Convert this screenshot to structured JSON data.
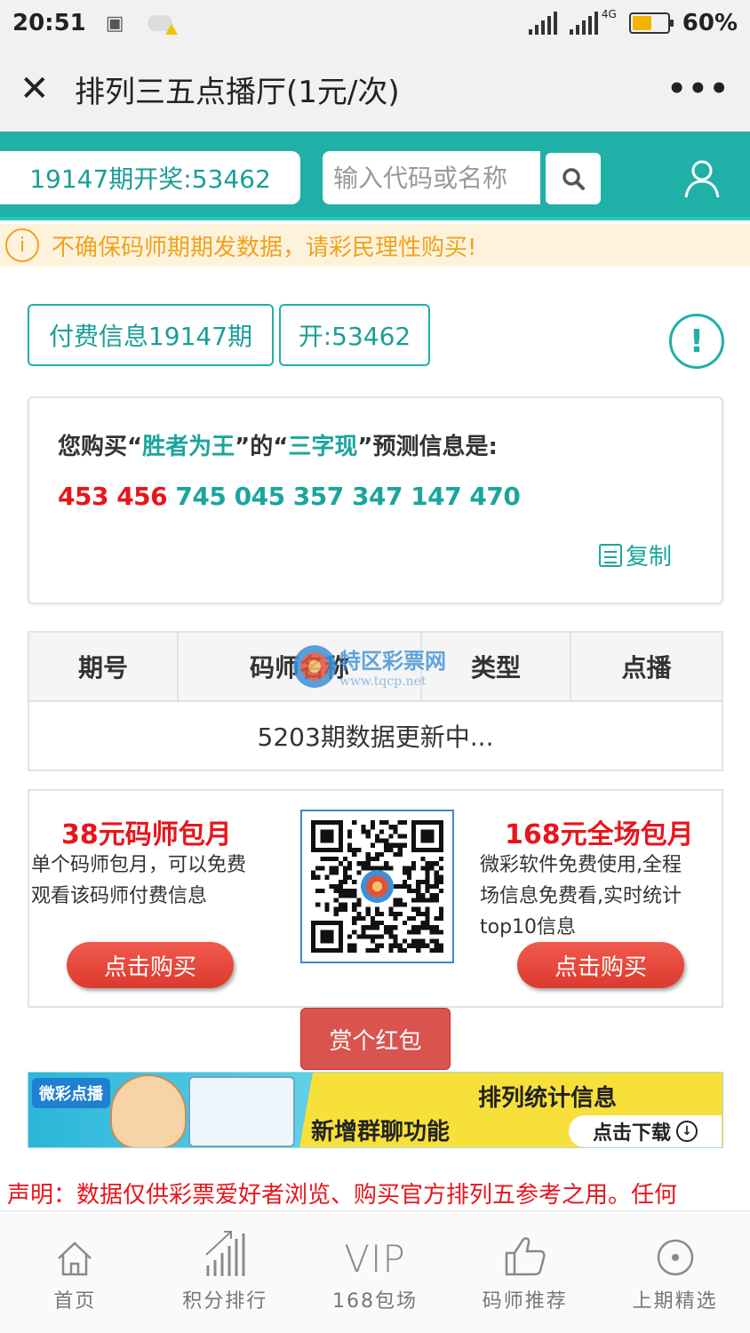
{
  "status_bar": {
    "time": "20:51",
    "network": "4G",
    "battery": "60%",
    "battery_level": 0.6
  },
  "titlebar": {
    "title": "排列三五点播厅(1元/次)",
    "close_icon": "close-icon",
    "more_icon": "more-dots-icon"
  },
  "header": {
    "draw_result": "19147期开奖:53462",
    "search_placeholder": "输入代码或名称",
    "accent_color": "#1fb0a8"
  },
  "warning": {
    "text": "不确保码师期期发数据，请彩民理性购买!",
    "color": "#f0a21e"
  },
  "info": {
    "paid_tag": "付费信息19147期",
    "open_tag": "开:53462",
    "alert_symbol": "!"
  },
  "prediction": {
    "prefix": "您购买",
    "lq1": "“",
    "rq1": "”",
    "master": "胜者为王",
    "mid": "的",
    "lq2": "“",
    "rq2": "”",
    "type": "三字现",
    "suffix": "预测信息是:",
    "numbers_red": "453 456",
    "numbers_teal": "745 045 357 347 147 470",
    "copy_label": "复制"
  },
  "table": {
    "headers": [
      "期号",
      "码师名称",
      "类型",
      "点播"
    ],
    "empty_message": "5203期数据更新中..."
  },
  "watermark": {
    "text": "特区彩票网",
    "url": "www.tqcp.net"
  },
  "promo": {
    "left_title": "38元码师包月",
    "left_desc_1": "单个码师包月，可以免费",
    "left_desc_2": "观看该码师付费信息",
    "left_button": "点击购买",
    "right_title": "168元全场包月",
    "right_desc_1": "微彩软件免费使用,全程",
    "right_desc_2": "场信息免费看,实时统计",
    "right_desc_3": "top10信息",
    "right_button": "点击购买"
  },
  "redpack_button": "赏个红包",
  "banner": {
    "brand": "微彩点播",
    "line1": "排列统计信息",
    "line2": "新增群聊功能",
    "download": "点击下载"
  },
  "notice": "声明：数据仅供彩票爱好者浏览、购买官方排列五参考之用。任何",
  "bottom_nav": [
    {
      "label": "首页",
      "icon": "home-icon"
    },
    {
      "label": "积分排行",
      "icon": "ranking-bars-icon"
    },
    {
      "label": "168包场",
      "icon_text": "VIP"
    },
    {
      "label": "码师推荐",
      "icon": "thumbs-up-icon"
    },
    {
      "label": "上期精选",
      "icon": "target-circle-icon"
    }
  ]
}
